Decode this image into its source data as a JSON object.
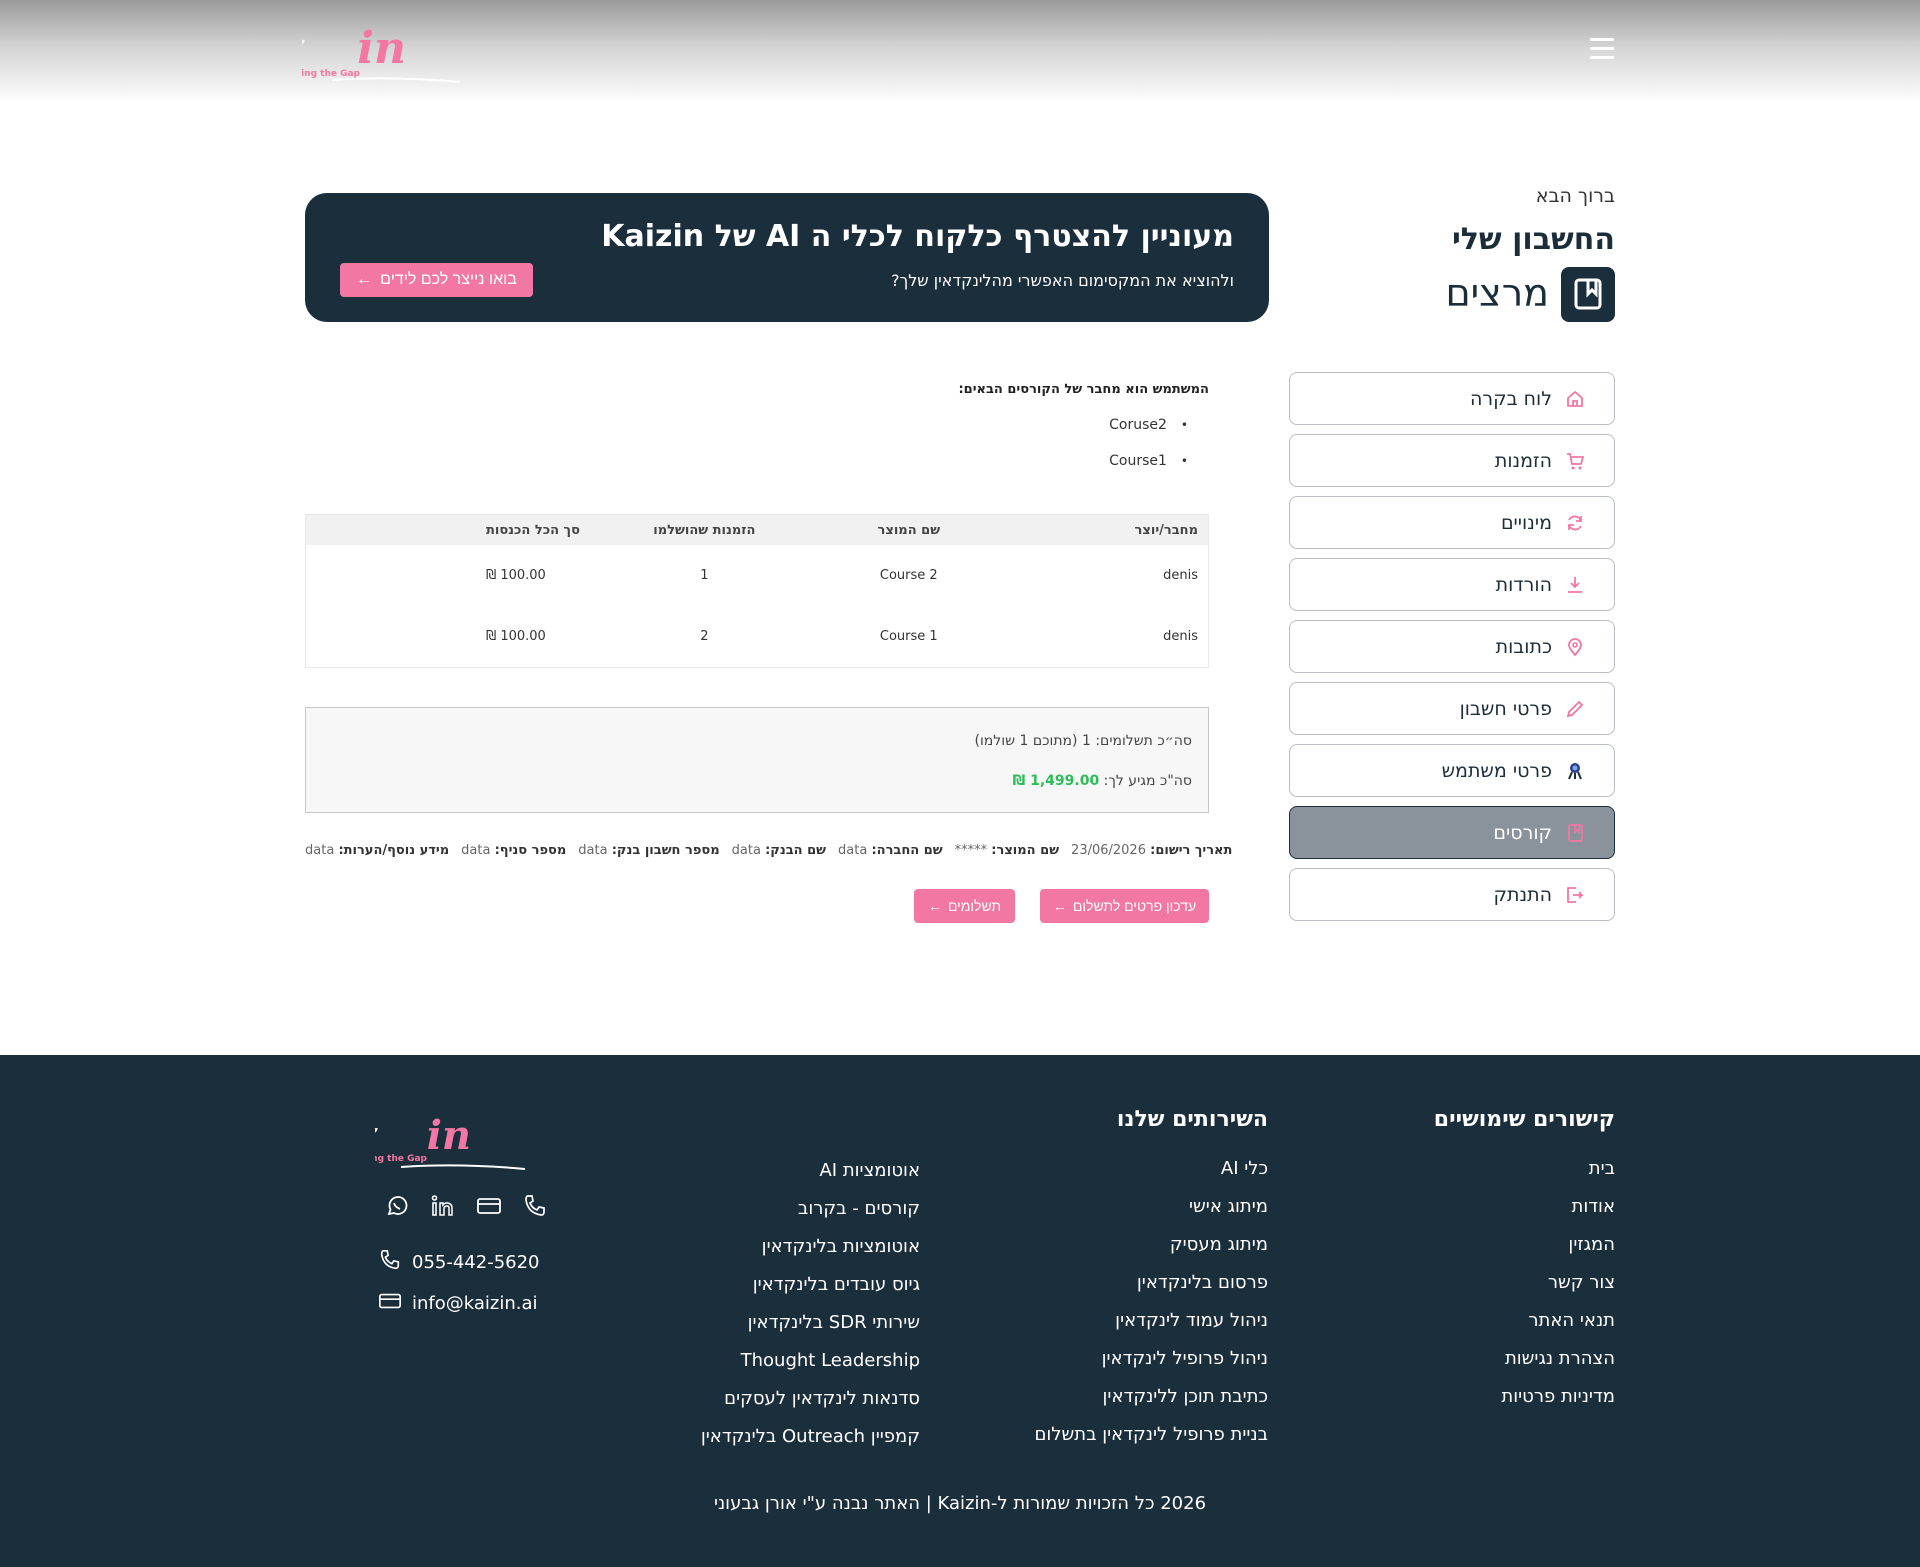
{
  "header": {
    "logo_text": "Kaizin",
    "logo_tagline": "Closing the Gap"
  },
  "account": {
    "welcome": "ברוך הבא",
    "title": "החשבון שלי",
    "brand_name": "מרצים"
  },
  "banner": {
    "title": "מעוניין להצטרף כלקוח לכלי ה AI של Kaizin",
    "subtitle": "ולהוציא את המקסימום האפשרי מהלינקדאין שלך?",
    "button": "בואו נייצר לכם לידים"
  },
  "nav": {
    "items": [
      {
        "label": "לוח בקרה",
        "icon": "home-icon"
      },
      {
        "label": "הזמנות",
        "icon": "cart-icon"
      },
      {
        "label": "מינויים",
        "icon": "refresh-icon"
      },
      {
        "label": "הורדות",
        "icon": "download-icon"
      },
      {
        "label": "כתובות",
        "icon": "location-pin-icon"
      },
      {
        "label": "פרטי חשבון",
        "icon": "pencil-icon"
      },
      {
        "label": "פרטי משתמש",
        "icon": "user-avatar-icon"
      },
      {
        "label": "קורסים",
        "icon": "book-icon",
        "active": true
      },
      {
        "label": "התנתק",
        "icon": "logout-icon"
      }
    ]
  },
  "courses": {
    "authors_title": "המשתמש הוא מחבר של הקורסים הבאים:",
    "list": [
      "Coruse2",
      "Course1"
    ]
  },
  "table": {
    "headers": [
      "מחבר/יוצר",
      "שם המוצר",
      "הזמנות שהושלמו",
      "סך הכל הכנסות"
    ],
    "rows": [
      {
        "author": "denis",
        "product": "Course 2",
        "orders": "1",
        "revenue": "100.00 ₪"
      },
      {
        "author": "denis",
        "product": "Course 1",
        "orders": "2",
        "revenue": "100.00 ₪"
      }
    ]
  },
  "summary": {
    "payments_line": "סה״כ תשלומים: 1 (מתוכם 1 שולמו)",
    "due_label": "סה\"כ מגיע לך:",
    "due_amount": "1,499.00 ₪"
  },
  "meta": [
    {
      "label": "תאריך רישום:",
      "value": "23/06/2026"
    },
    {
      "label": "שם המוצר:",
      "value": "*****"
    },
    {
      "label": "שם החברה:",
      "value": "data"
    },
    {
      "label": "שם הבנק:",
      "value": "data"
    },
    {
      "label": "מספר חשבון בנק:",
      "value": "data"
    },
    {
      "label": "מספר סניף:",
      "value": "data"
    },
    {
      "label": "מידע נוסף/הערות:",
      "value": "data"
    }
  ],
  "buttons": {
    "update_payment": "עדכון פרטים לתשלום",
    "payments": "תשלומים"
  },
  "footer": {
    "useful_links": {
      "title": "קישורים שימושיים",
      "items": [
        "בית",
        "אודות",
        "המגזין",
        "צור קשר",
        "תנאי האתר",
        "הצהרת נגישות",
        "מדיניות פרטיות"
      ]
    },
    "services": {
      "title": "השירותים שלנו",
      "col1": [
        "כלי AI",
        "מיתוג אישי",
        "מיתוג מעסיק",
        "פרסום בלינקדאין",
        "ניהול עמוד לינקדאין",
        "ניהול פרופיל לינקדאין",
        "כתיבת תוכן ללינקדאין",
        "בניית פרופיל לינקדאין בתשלום"
      ],
      "col2": [
        "אוטומציות AI",
        "קורסים - בקרוב",
        "אוטומציות בלינקדאין",
        "גיוס עובדים בלינקדאין",
        "שירותי SDR בלינקדאין",
        "Thought Leadership",
        "סדנאות לינקדאין לעסקים",
        "קמפיין Outreach בלינקדאין"
      ]
    },
    "phone": "055-442-5620",
    "email": "info@kaizin.ai",
    "copyright": "2026 כל הזכויות שמורות ל-Kaizin | האתר נבנה ע\"י אורן גבעוני"
  },
  "colors": {
    "navy": "#1b2e3c",
    "pink": "#f277a3",
    "green": "#2ebc5a"
  }
}
